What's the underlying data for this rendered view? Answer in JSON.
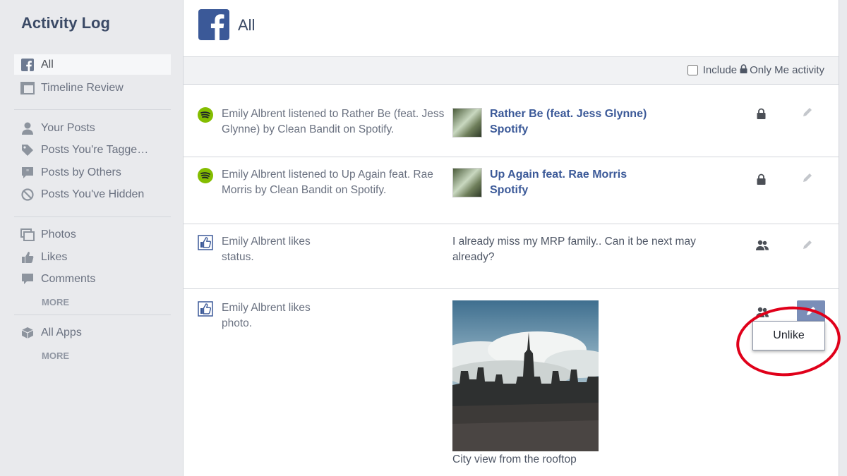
{
  "sidebar": {
    "title": "Activity Log",
    "group1": [
      {
        "label": "All",
        "icon": "facebook-icon",
        "active": true
      },
      {
        "label": "Timeline Review",
        "icon": "timeline-icon"
      }
    ],
    "group2": [
      {
        "label": "Your Posts",
        "icon": "person-icon"
      },
      {
        "label": "Posts You're Tagge…",
        "icon": "tag-icon"
      },
      {
        "label": "Posts by Others",
        "icon": "quote-bubble-icon"
      },
      {
        "label": "Posts You've Hidden",
        "icon": "hidden-icon"
      }
    ],
    "group3": [
      {
        "label": "Photos",
        "icon": "photos-icon"
      },
      {
        "label": "Likes",
        "icon": "thumbs-up-icon"
      },
      {
        "label": "Comments",
        "icon": "comment-icon"
      }
    ],
    "more1": "MORE",
    "group4": [
      {
        "label": "All Apps",
        "icon": "apps-cube-icon"
      }
    ],
    "more2": "MORE"
  },
  "header": {
    "title": "All"
  },
  "filter": {
    "include": "Include",
    "only_me": "Only Me activity"
  },
  "rows": [
    {
      "name": "Emily Albrent",
      "verb": "listened to",
      "track": "Rather Be (feat. Jess Glynne)",
      "by": "by",
      "artist": "Clean Bandit",
      "on": "on",
      "service": "Spotify.",
      "media_title": "Rather Be (feat. Jess Glynne)",
      "media_sub": "Spotify"
    },
    {
      "name": "Emily Albrent",
      "verb": "listened to",
      "track": "Up Again feat. Rae Morris",
      "by": "by",
      "artist": "Clean Bandit",
      "on": "on",
      "service": "Spotify.",
      "media_title": "Up Again feat. Rae Morris",
      "media_sub": "Spotify"
    },
    {
      "name": "Emily Albrent",
      "verb": "likes",
      "object": "status.",
      "content": "I already miss my MRP family.. Can it be next may already?"
    },
    {
      "name": "Emily Albrent",
      "verb": "likes",
      "object": "photo.",
      "caption": "City view from the rooftop"
    }
  ],
  "menu": {
    "unlike": "Unlike"
  },
  "colors": {
    "brand": "#3b5998",
    "annotation": "#e0001a",
    "spotify": "#84bd00"
  }
}
